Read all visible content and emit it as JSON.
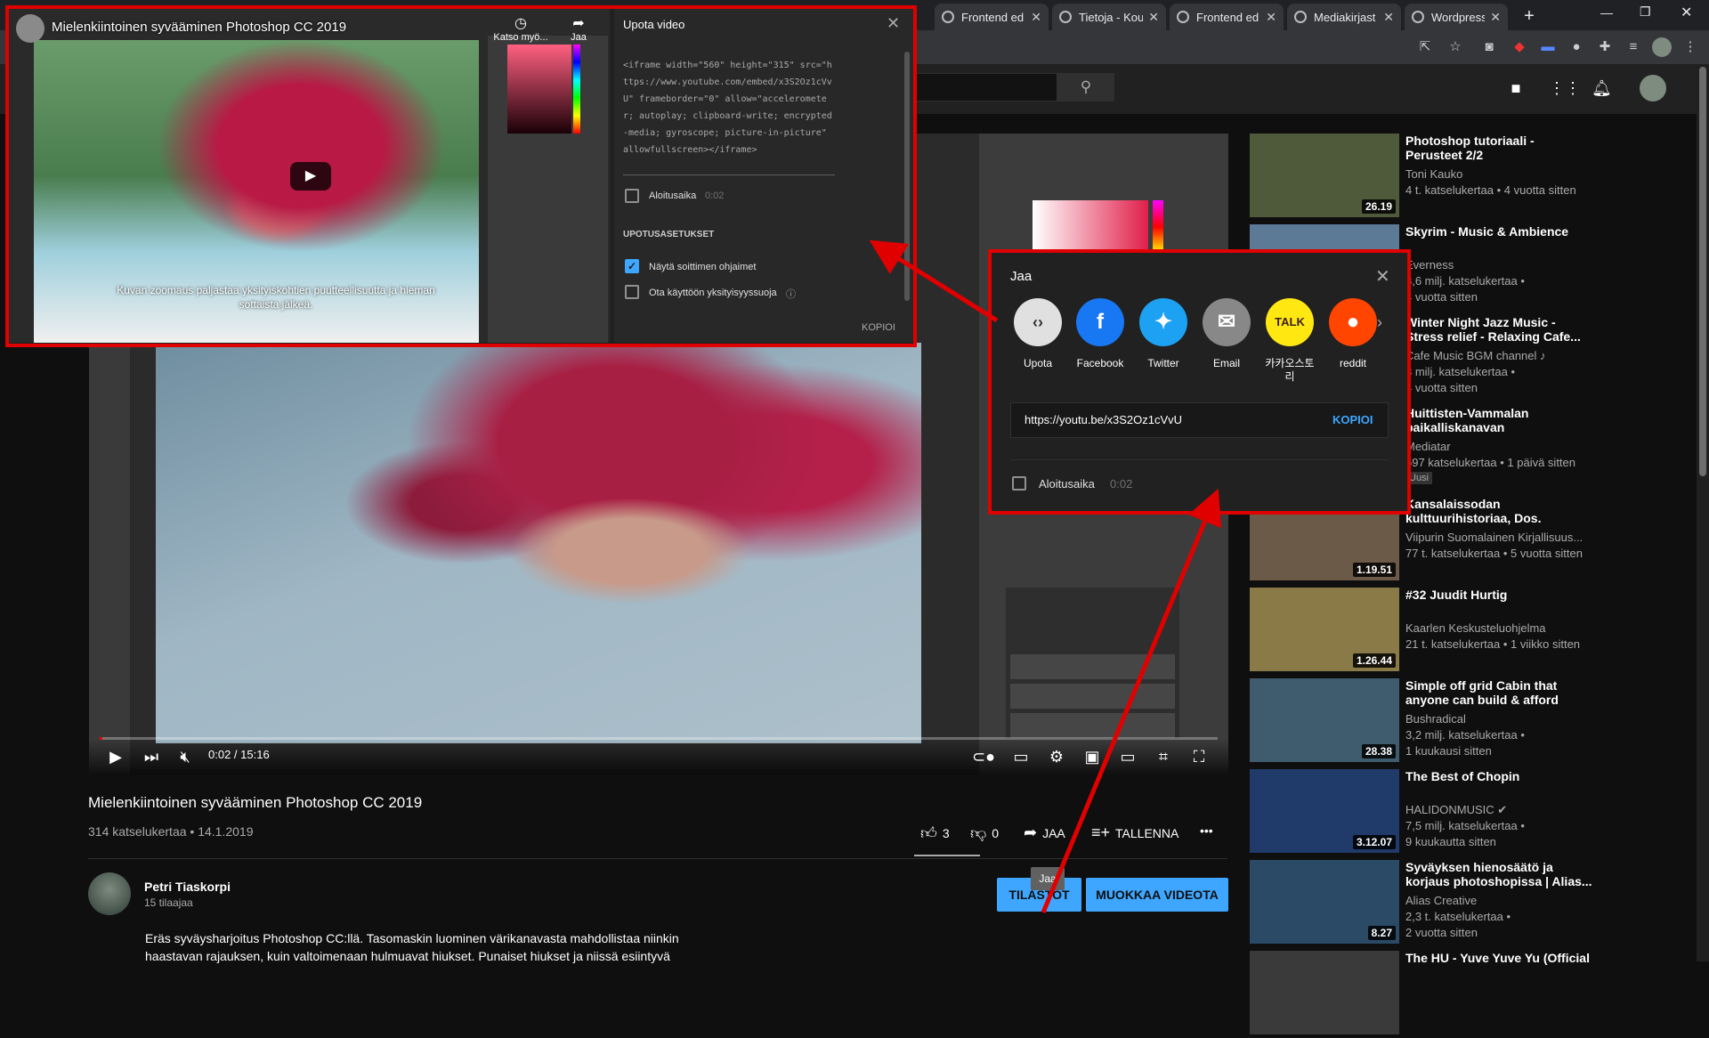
{
  "browser": {
    "tabs": [
      {
        "label": "Frontend ed"
      },
      {
        "label": "Tietoja - Kou"
      },
      {
        "label": "Frontend ed"
      },
      {
        "label": "Mediakirjast"
      },
      {
        "label": "Wordpress"
      }
    ],
    "new_tab": "+"
  },
  "player": {
    "timecode": "0:02 / 15:16",
    "progress_percent": 0.2
  },
  "video": {
    "title": "Mielenkiintoinen syvääminen Photoshop CC 2019",
    "meta": "314 katselukertaa • 14.1.2019",
    "likes": "3",
    "dislikes": "0",
    "share_label": "JAA",
    "save_label": "TALLENNA",
    "more_label": "•••",
    "tooltip": "Jaa"
  },
  "channel": {
    "name": "Petri Tiaskorpi",
    "subscribers": "15 tilaajaa",
    "stats_button": "TILASTOT",
    "edit_button": "MUOKKAA VIDEOTA",
    "description": "Eräs syväysharjoitus Photoshop CC:llä. Tasomaskin luominen värikanavasta mahdollistaa niinkin haastavan rajauksen, kuin valtoimenaan hulmuavat hiukset. Punaiset hiukset ja niissä esiintyvä"
  },
  "embed": {
    "video_title": "Mielenkiintoinen syvääminen Photoshop CC 2019",
    "watch_later": "Katso myö...",
    "share": "Jaa",
    "caption": "Kuvan zoomaus paljastaa yksityiskohtien puutteellisuutta ja hieman sottaista jälkeä.",
    "panel_title": "Upota video",
    "code": "<iframe width=\"560\" height=\"315\" src=\"https://www.youtube.com/embed/x3S2Oz1cVvU\" frameborder=\"0\" allow=\"accelerometer; autoplay; clipboard-write; encrypted-media; gyroscope; picture-in-picture\" allowfullscreen></iframe>",
    "start_label": "Aloitusaika",
    "start_time": "0:02",
    "settings_header": "UPOTUSASETUKSET",
    "option_controls": "Näytä soittimen ohjaimet",
    "option_privacy": "Ota käyttöön yksityisyyssuoja",
    "copy": "KOPIOI"
  },
  "share": {
    "title": "Jaa",
    "targets": [
      {
        "label": "Upota",
        "icon": "embed-icon",
        "color": "#e0e0e0"
      },
      {
        "label": "Facebook",
        "icon": "facebook-icon",
        "color": "#1877f2"
      },
      {
        "label": "Twitter",
        "icon": "twitter-icon",
        "color": "#1da1f2"
      },
      {
        "label": "Email",
        "icon": "email-icon",
        "color": "#888888"
      },
      {
        "label": "카카오스토리",
        "icon": "kakao-icon",
        "color": "#ffe812"
      },
      {
        "label": "reddit",
        "icon": "reddit-icon",
        "color": "#ff4500"
      }
    ],
    "url": "https://youtu.be/x3S2Oz1cVvU",
    "copy": "KOPIOI",
    "start_label": "Aloitusaika",
    "start_time": "0:02"
  },
  "sidebar": {
    "items": [
      {
        "title": "Photoshop tutoriaali - Perusteet 2/2",
        "channel": "Toni Kauko",
        "views": "4 t. katselukertaa • 4 vuotta sitten",
        "views2": "",
        "duration": "26.19",
        "thumb": "#4f5a3a"
      },
      {
        "title": "Skyrim - Music & Ambience",
        "channel": "Everness",
        "views": "8,6 milj. katselukertaa •",
        "views2": "4 vuotta sitten",
        "duration": "",
        "thumb": "#5c7a95"
      },
      {
        "title": "Winter Night Jazz Music - Stress relief - Relaxing Cafe...",
        "channel": "Cafe Music BGM channel ♪",
        "views": "3 milj. katselukertaa •",
        "views2": "4 vuotta sitten",
        "duration": "",
        "thumb": "#3b3b52"
      },
      {
        "title": "Huittisten-Vammalan paikalliskanavan uudenvuode...",
        "channel": "Mediatar",
        "views": "597 katselukertaa • 1 päivä sitten",
        "views2": "",
        "badge": "Uusi",
        "duration": "",
        "thumb": "#444"
      },
      {
        "title": "Kansalaissodan kulttuurihistoriaa, Dos. Teemu...",
        "channel": "Viipurin Suomalainen Kirjallisuus...",
        "views": "77 t. katselukertaa • 5 vuotta sitten",
        "views2": "",
        "duration": "1.19.51",
        "thumb": "#6b5a48"
      },
      {
        "title": "#32 Juudit Hurtig",
        "channel": "Kaarlen Keskusteluohjelma",
        "views": "21 t. katselukertaa • 1 viikko sitten",
        "views2": "",
        "duration": "1.26.44",
        "thumb": "#8a7a48"
      },
      {
        "title": "Simple off grid Cabin that anyone can build & afford",
        "channel": "Bushradical",
        "views": "3,2 milj. katselukertaa •",
        "views2": "1 kuukausi sitten",
        "duration": "28.38",
        "thumb": "#3f5c6e"
      },
      {
        "title": "The Best of Chopin",
        "channel": "HALIDONMUSIC ✔",
        "views": "7,5 milj. katselukertaa •",
        "views2": "9 kuukautta sitten",
        "duration": "3.12.07",
        "thumb": "#203a6a"
      },
      {
        "title": "Syväyksen hienosäätö ja korjaus photoshopissa | Alias...",
        "channel": "Alias Creative",
        "views": "2,3 t. katselukertaa •",
        "views2": "2 vuotta sitten",
        "duration": "8.27",
        "thumb": "#2a4a66"
      },
      {
        "title": "The HU - Yuve Yuve Yu (Official",
        "channel": "",
        "views": "",
        "views2": "",
        "duration": "",
        "thumb": "#3a3a3a"
      }
    ]
  }
}
